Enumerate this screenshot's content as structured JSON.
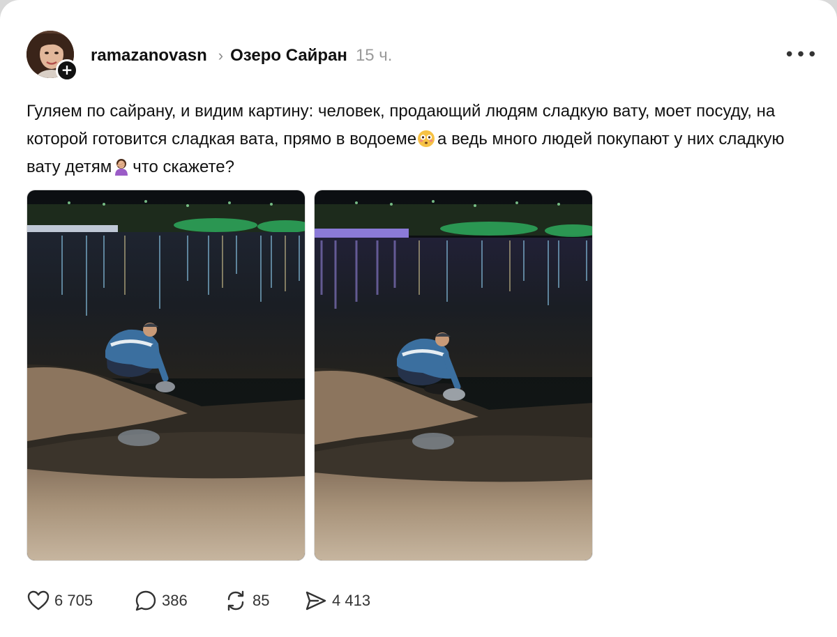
{
  "post": {
    "username": "ramazanovasn",
    "topic": "Озеро Сайран",
    "time": "15 ч.",
    "text_part1": "Гуляем по сайрану, и видим картину: человек, продающий людям сладкую вату, моет посуду, на которой готовится сладкая вата, прямо в водоеме",
    "text_part2": "а ведь много людей покупают у них сладкую вату детям",
    "text_part3": "что скажете?"
  },
  "icons": {
    "follow": "plus-icon",
    "more": "more-dots-icon",
    "emoji1": "flushed-face-emoji",
    "emoji2": "woman-facepalming-emoji",
    "like": "heart-icon",
    "comment": "comment-bubble-icon",
    "repost": "repost-icon",
    "share": "send-icon"
  },
  "stats": {
    "likes": "6 705",
    "comments": "386",
    "reposts": "85",
    "shares": "4 413"
  },
  "colors": {
    "text": "#111111",
    "muted": "#9a9a9a",
    "water": "#1b1e22",
    "sand": "#b8a58a",
    "jacket": "#3b6f9f"
  }
}
